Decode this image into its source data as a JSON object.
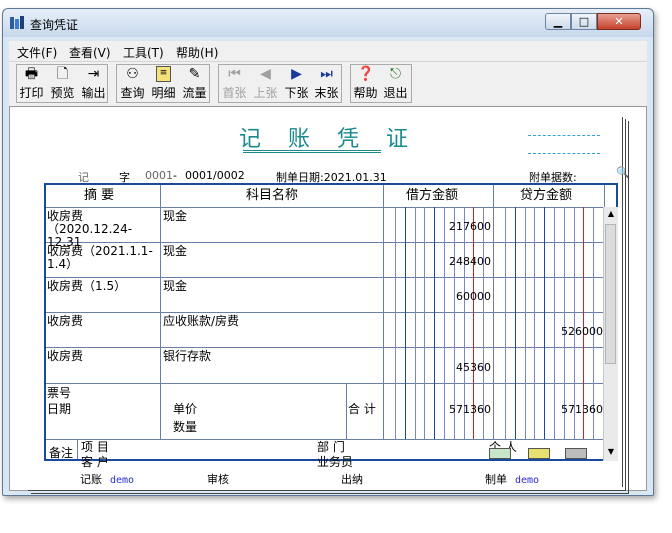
{
  "window": {
    "title": "查询凭证"
  },
  "menu": [
    "文件(F)",
    "查看(V)",
    "工具(T)",
    "帮助(H)"
  ],
  "toolbar": [
    {
      "label": "打印",
      "icon": "printer-icon"
    },
    {
      "label": "预览",
      "icon": "preview-icon"
    },
    {
      "label": "输出",
      "icon": "export-icon"
    },
    {
      "label": "查询",
      "icon": "binoculars-icon"
    },
    {
      "label": "明细",
      "icon": "detail-icon"
    },
    {
      "label": "流量",
      "icon": "cashflow-icon"
    },
    {
      "label": "首张",
      "icon": "first-icon",
      "disabled": true
    },
    {
      "label": "上张",
      "icon": "prev-icon",
      "disabled": true
    },
    {
      "label": "下张",
      "icon": "next-icon"
    },
    {
      "label": "末张",
      "icon": "last-icon"
    },
    {
      "label": "帮助",
      "icon": "help-icon"
    },
    {
      "label": "退出",
      "icon": "exit-icon"
    }
  ],
  "voucher": {
    "title": "记 账 凭 证",
    "type_label": "记",
    "zi_label": "字",
    "number_prefix": "0001",
    "dash": "-",
    "number": "0001/0002",
    "date_label": "制单日期:2021.01.31",
    "attach_label": "附单据数:",
    "headers": {
      "summary": "摘 要",
      "account": "科目名称",
      "debit": "借方金额",
      "credit": "贷方金额"
    },
    "rows": [
      {
        "summary": "收房费（2020.12.24-12.31",
        "account": "现金",
        "debit": "217600",
        "credit": ""
      },
      {
        "summary": "收房费（2021.1.1-1.4）",
        "account": "现金",
        "debit": "248400",
        "credit": ""
      },
      {
        "summary": "收房费（1.5）",
        "account": "现金",
        "debit": "60000",
        "credit": ""
      },
      {
        "summary": "收房费",
        "account": "应收账款/房费",
        "debit": "",
        "credit": "526000"
      },
      {
        "summary": "收房费",
        "account": "银行存款",
        "debit": "45360",
        "credit": ""
      }
    ],
    "total": {
      "ticket_label": "票号",
      "date_label": "日期",
      "price_label": "单价",
      "qty_label": "数量",
      "total_label": "合 计",
      "debit": "571360",
      "credit": "571360"
    },
    "notes": {
      "label": "备注",
      "project": "项  目",
      "customer": "客  户",
      "dept": "部  门",
      "salesperson": "业务员",
      "person": "个  人"
    },
    "footer": {
      "bookkeep_label": "记账",
      "bookkeep_value": "demo",
      "audit_label": "审核",
      "cashier_label": "出纳",
      "maker_label": "制单",
      "maker_value": "demo"
    }
  },
  "colors": {
    "accent": "#1a8a8f",
    "frame": "#1a4b9a",
    "red": "#d02020"
  }
}
